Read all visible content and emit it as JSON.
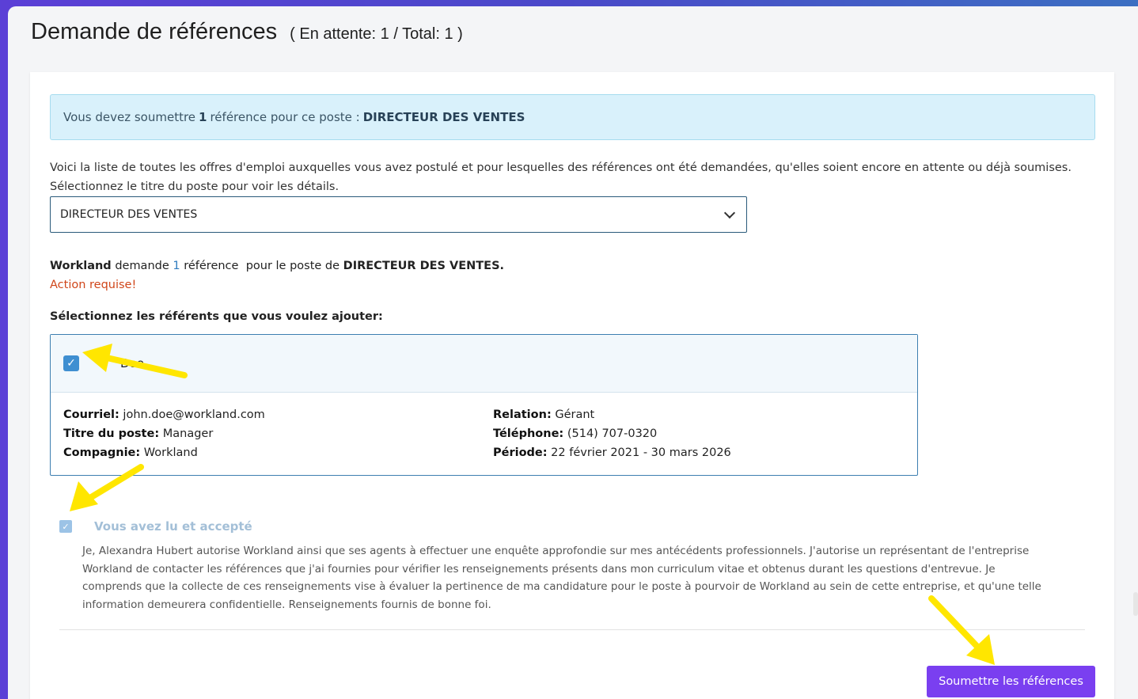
{
  "header": {
    "title": "Demande de références",
    "counts": "( En attente: 1 / Total: 1 )"
  },
  "banner": {
    "prefix": "Vous devez soumettre",
    "count": "1",
    "middle": "référence pour ce poste :",
    "position": "DIRECTEUR DES VENTES"
  },
  "description": "Voici la liste de toutes les offres d'emploi auxquelles vous avez postulé et pour lesquelles des références ont été demandées, qu'elles soient encore en attente ou déjà soumises. Sélectionnez le titre du poste pour voir les détails.",
  "job_select": {
    "value": "DIRECTEUR DES VENTES"
  },
  "request": {
    "company": "Workland",
    "verb": "demande",
    "count": "1",
    "unit": "référence",
    "middle": "pour le poste de",
    "position": "DIRECTEUR DES VENTES."
  },
  "action_required": "Action requise!",
  "select_referents_title": "Sélectionnez les référents que vous voulez ajouter:",
  "referent": {
    "checked": true,
    "name": "Doe",
    "email_label": "Courriel:",
    "email": "john.doe@workland.com",
    "job_title_label": "Titre du poste:",
    "job_title": "Manager",
    "company_label": "Compagnie:",
    "company": "Workland",
    "relation_label": "Relation:",
    "relation": "Gérant",
    "phone_label": "Téléphone:",
    "phone": "(514) 707-0320",
    "period_label": "Période:",
    "period": "22 février 2021 - 30 mars 2026"
  },
  "consent": {
    "checked": true,
    "label": "Vous avez lu et accepté",
    "text": "Je, Alexandra Hubert autorise Workland ainsi que ses agents à effectuer une enquête approfondie sur mes antécédents professionnels. J'autorise un représentant de l'entreprise Workland de contacter les références que j'ai fournies pour vérifier les renseignements présents dans mon curriculum vitae et obtenus durant les questions d'entrevue. Je comprends que la collecte de ces renseignements vise à évaluer la pertinence de ma candidature pour le poste à pourvoir de Workland au sein de cette entreprise, et qu'une telle information demeurera confidentielle. Renseignements fournis de bonne foi."
  },
  "submit_label": "Soumettre les références",
  "colors": {
    "accent": "#7a3ff0",
    "banner_bg": "#d9f1fb",
    "checkbox": "#3f8fd1",
    "warning": "#d0461a",
    "annotation_arrow": "#ffe600"
  },
  "icons": [
    "check-icon",
    "chevron-down-icon",
    "annotation-arrow"
  ]
}
